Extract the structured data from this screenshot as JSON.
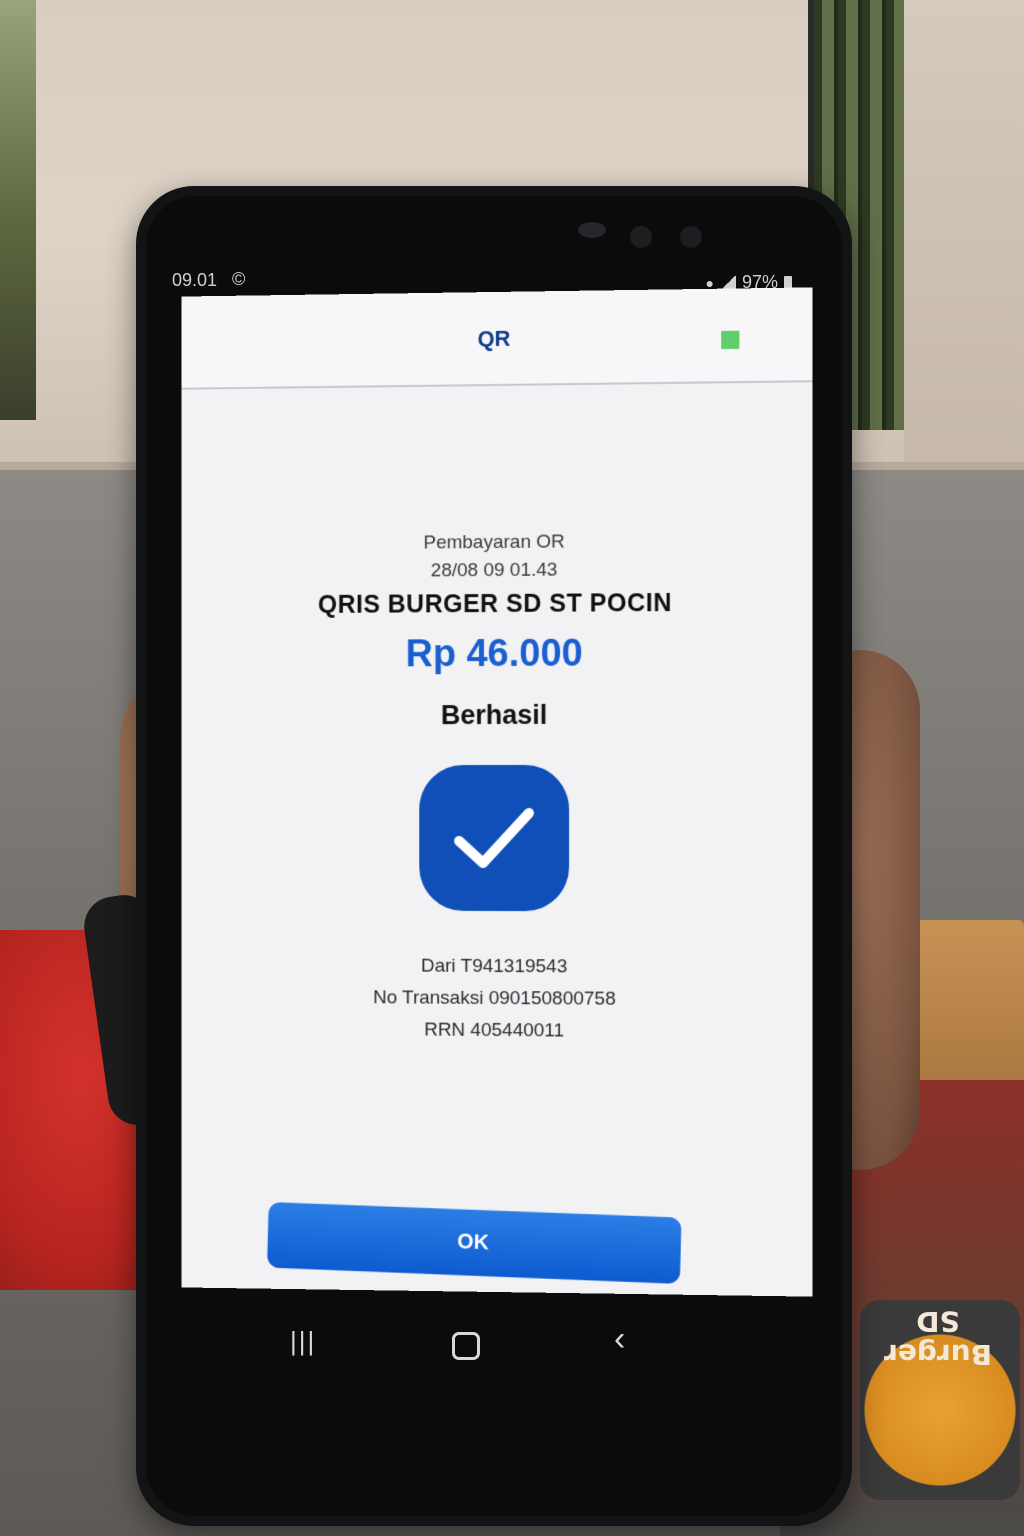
{
  "status_bar": {
    "time": "09.01",
    "c_icon": "©",
    "battery": "97%"
  },
  "app": {
    "title": "QR",
    "status_color": "#5fce6b"
  },
  "transaction": {
    "type": "Pembayaran OR",
    "datetime": "28/08 09 01.43",
    "merchant": "QRIS BURGER SD ST POCIN",
    "amount": "Rp 46.000",
    "status": "Berhasil",
    "from": "Dari T941319543",
    "tx_number": "No Transaksi 090150800758",
    "rrn": "RRN 405440011"
  },
  "buttons": {
    "ok_label": "OK"
  },
  "nav": {
    "recents": "|||",
    "back": "‹"
  },
  "background": {
    "mat_text": "Burger SD"
  },
  "colors": {
    "accent": "#1b5ed1",
    "check_badge": "#0f4fb7",
    "title": "#0e3b8c"
  }
}
